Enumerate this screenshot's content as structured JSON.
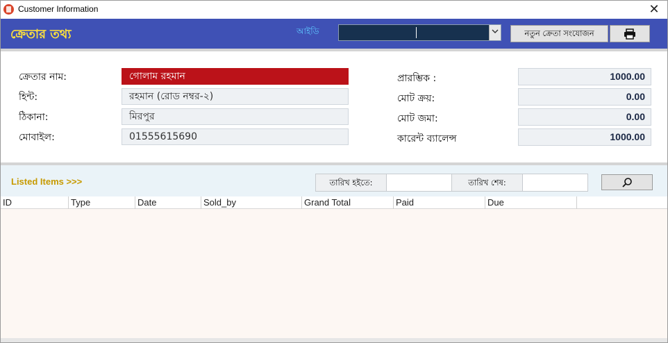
{
  "window": {
    "title": "Customer Information",
    "close_glyph": "✕"
  },
  "header": {
    "title": "ক্রেতার তথ্য",
    "id_label": "আইডি",
    "id_value": "",
    "new_button": "নতুন ক্রেতা সংযোজন",
    "print_icon": "printer-icon"
  },
  "customer": {
    "name_label": "ক্রেতার নাম:",
    "name_value": "গোলাম রহমান",
    "hint_label": "হিন্ট:",
    "hint_value": "রহমান (রোড নম্বর-২)",
    "address_label": "ঠিকানা:",
    "address_value": "মিরপুর",
    "mobile_label": "মোবাইল:",
    "mobile_value": "01555615690"
  },
  "balance": {
    "opening_label": "প্রারম্ভিক :",
    "opening_value": "1000.00",
    "total_purchase_label": "মোট ক্রয়:",
    "total_purchase_value": "0.00",
    "total_deposit_label": "মোট জমা:",
    "total_deposit_value": "0.00",
    "current_label": "কারেন্ট ব্যালেন্স",
    "current_value": "1000.00"
  },
  "filter": {
    "listed_items": "Listed Items >>>",
    "date_from_label": "তারিখ হইতে:",
    "date_from_value": "",
    "date_to_label": "তারিখ শেষ:",
    "date_to_value": "",
    "search_icon": "search-icon"
  },
  "table": {
    "columns": [
      "ID",
      "Type",
      "Date",
      "Sold_by",
      "Grand Total",
      "Paid",
      "Due"
    ],
    "rows": []
  },
  "colors": {
    "header_bg": "#3f51b5",
    "header_title": "#ffe23c",
    "name_highlight": "#bb1219",
    "listed_items": "#c79a00"
  }
}
